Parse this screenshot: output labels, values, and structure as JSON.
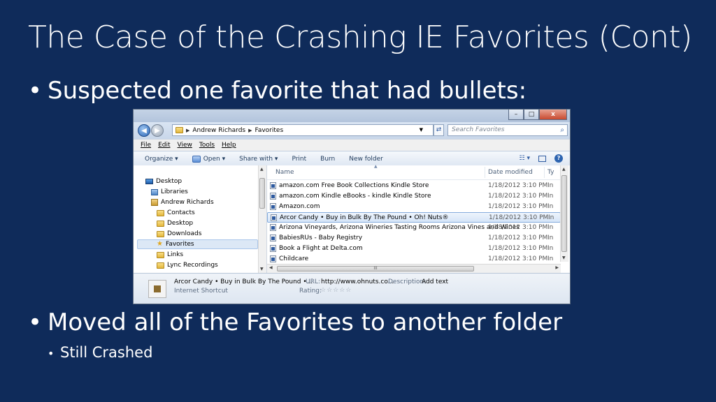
{
  "slide": {
    "title": "The Case of the Crashing IE Favorites (Cont)",
    "bullet1": "Suspected one favorite that had bullets:",
    "bullet2": "Moved all of the Favorites to another folder",
    "sub_bullet": "Still Crashed",
    "bullet_glyph": "•",
    "background_color": "#0f2b5a"
  },
  "window": {
    "controls": {
      "minimize": "–",
      "maximize": "□",
      "close": "x"
    },
    "address": {
      "parts": [
        "Andrew Richards",
        "Favorites"
      ]
    },
    "search_placeholder": "Search Favorites",
    "menu": [
      "File",
      "Edit",
      "View",
      "Tools",
      "Help"
    ],
    "toolbar": {
      "organize": "Organize ▾",
      "open": "Open ▾",
      "share_with": "Share with ▾",
      "print": "Print",
      "burn": "Burn",
      "new_folder": "New folder"
    },
    "nav_items": [
      {
        "label": "Desktop",
        "icon": "desktop-icon"
      },
      {
        "label": "Libraries",
        "icon": "library-icon"
      },
      {
        "label": "Andrew Richards",
        "icon": "user-folder-icon"
      },
      {
        "label": "Contacts",
        "icon": "folder-icon"
      },
      {
        "label": "Desktop",
        "icon": "folder-icon"
      },
      {
        "label": "Downloads",
        "icon": "folder-icon"
      },
      {
        "label": "Favorites",
        "icon": "star-icon"
      },
      {
        "label": "Links",
        "icon": "folder-icon"
      },
      {
        "label": "Lync Recordings",
        "icon": "folder-icon"
      }
    ],
    "columns": {
      "name": "Name",
      "date": "Date modified",
      "type": "Ty"
    },
    "files": [
      {
        "name": "amazon.com Free Book Collections Kindle Store",
        "date": "1/18/2012 3:10 PM",
        "type": "In"
      },
      {
        "name": "amazon.com Kindle eBooks - kindle Kindle Store",
        "date": "1/18/2012 3:10 PM",
        "type": "In"
      },
      {
        "name": "Amazon.com",
        "date": "1/18/2012 3:10 PM",
        "type": "In"
      },
      {
        "name": "Arcor Candy • Buy in Bulk By The Pound • Oh! Nuts®",
        "date": "1/18/2012 3:10 PM",
        "type": "In"
      },
      {
        "name": "Arizona Vineyards, Arizona Wineries Tasting Rooms Arizona Vines and Wines",
        "date": "1/18/2012 3:10 PM",
        "type": "In"
      },
      {
        "name": "BabiesRUs - Baby Registry",
        "date": "1/18/2012 3:10 PM",
        "type": "In"
      },
      {
        "name": "Book a Flight at Delta.com",
        "date": "1/18/2012 3:10 PM",
        "type": "In"
      },
      {
        "name": "Childcare",
        "date": "1/18/2012 3:10 PM",
        "type": "In"
      }
    ],
    "selected_index": 3,
    "hscroll_grip": "III",
    "details": {
      "name": "Arcor Candy • Buy in Bulk By The Pound •...",
      "kind": "Internet Shortcut",
      "url_label": "URL:",
      "url_value": "http://www.ohnuts.co...",
      "desc_label": "Description:",
      "desc_value": "Add text",
      "rating_label": "Rating:",
      "rating_stars": "☆☆☆☆☆"
    }
  }
}
